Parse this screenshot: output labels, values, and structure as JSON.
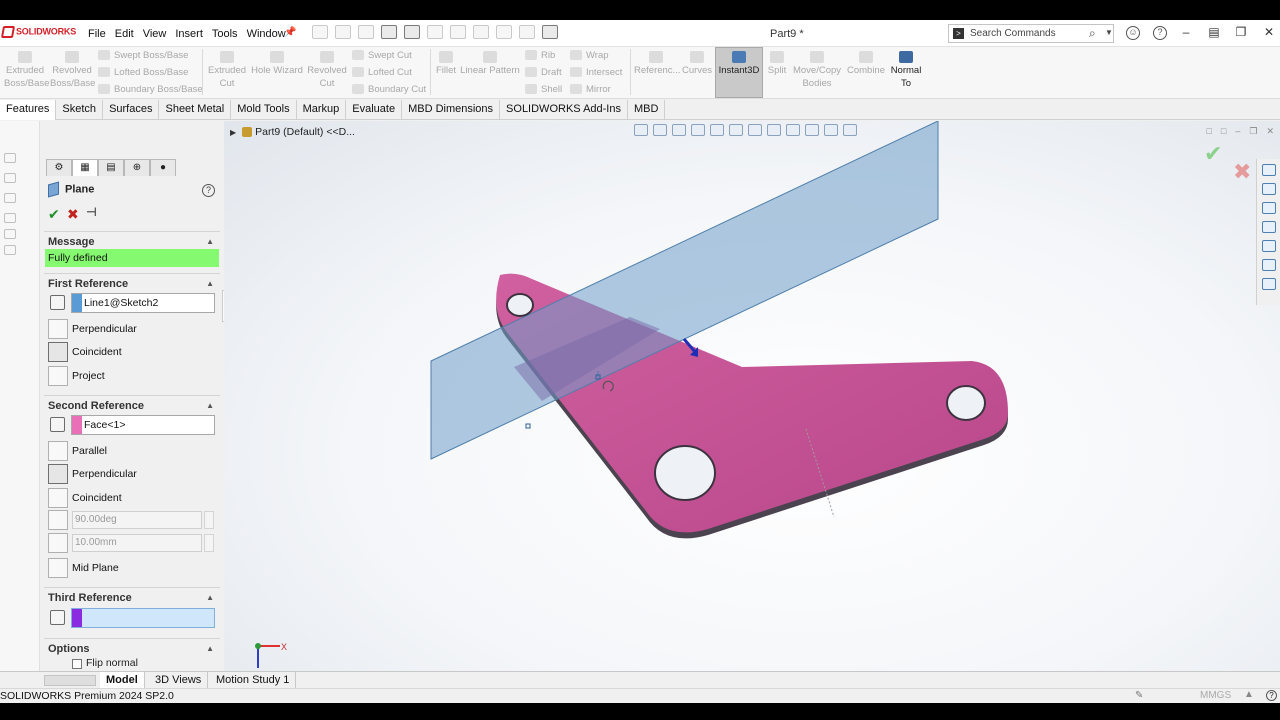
{
  "app": {
    "logo_text": "SOLIDWORKS",
    "document_title": "Part9 *",
    "status_text": "SOLIDWORKS Premium 2024 SP2.0",
    "units": "MMGS"
  },
  "menu": [
    "File",
    "Edit",
    "View",
    "Insert",
    "Tools",
    "Window"
  ],
  "search": {
    "placeholder": "Search Commands"
  },
  "commands": {
    "extruded_boss": "Extruded Boss/Base",
    "revolved_boss": "Revolved Boss/Base",
    "swept_boss": "Swept Boss/Base",
    "lofted_boss": "Lofted Boss/Base",
    "boundary_boss": "Boundary Boss/Base",
    "extruded_cut": "Extruded Cut",
    "hole_wizard": "Hole Wizard",
    "revolved_cut": "Revolved Cut",
    "swept_cut": "Swept Cut",
    "lofted_cut": "Lofted Cut",
    "boundary_cut": "Boundary Cut",
    "fillet": "Fillet",
    "linear_pattern": "Linear Pattern",
    "rib": "Rib",
    "draft": "Draft",
    "shell": "Shell",
    "wrap": "Wrap",
    "intersect": "Intersect",
    "mirror": "Mirror",
    "reference": "Referenc...",
    "curves": "Curves",
    "instant3d": "Instant3D",
    "split": "Split",
    "move_copy": "Move/Copy Bodies",
    "combine": "Combine",
    "normal_to": "Normal To"
  },
  "tabs": [
    "Features",
    "Sketch",
    "Surfaces",
    "Sheet Metal",
    "Mold Tools",
    "Markup",
    "Evaluate",
    "MBD Dimensions",
    "SOLIDWORKS Add-Ins",
    "MBD"
  ],
  "tree": {
    "root": "Part9 (Default) <<D..."
  },
  "property_manager": {
    "title": "Plane",
    "message": {
      "header": "Message",
      "text": "Fully defined"
    },
    "first_reference": {
      "header": "First Reference",
      "value": "Line1@Sketch2",
      "color": "#5b9bd5",
      "options": [
        "Perpendicular",
        "Coincident",
        "Project"
      ]
    },
    "second_reference": {
      "header": "Second Reference",
      "value": "Face<1>",
      "color": "#e86fb8",
      "options": [
        "Parallel",
        "Perpendicular",
        "Coincident"
      ],
      "angle": "90.00deg",
      "distance": "10.00mm",
      "mid_plane": "Mid Plane"
    },
    "third_reference": {
      "header": "Third Reference",
      "value": "",
      "color": "#8a2be2"
    },
    "options": {
      "header": "Options",
      "flip_normal": "Flip normal"
    }
  },
  "bottom_tabs": [
    "Model",
    "3D Views",
    "Motion Study 1"
  ],
  "colors": {
    "part": "#c8548e",
    "plane": "#6f9ec9",
    "accent": "#4a7bb5"
  },
  "triad": {
    "x_label": "X"
  }
}
